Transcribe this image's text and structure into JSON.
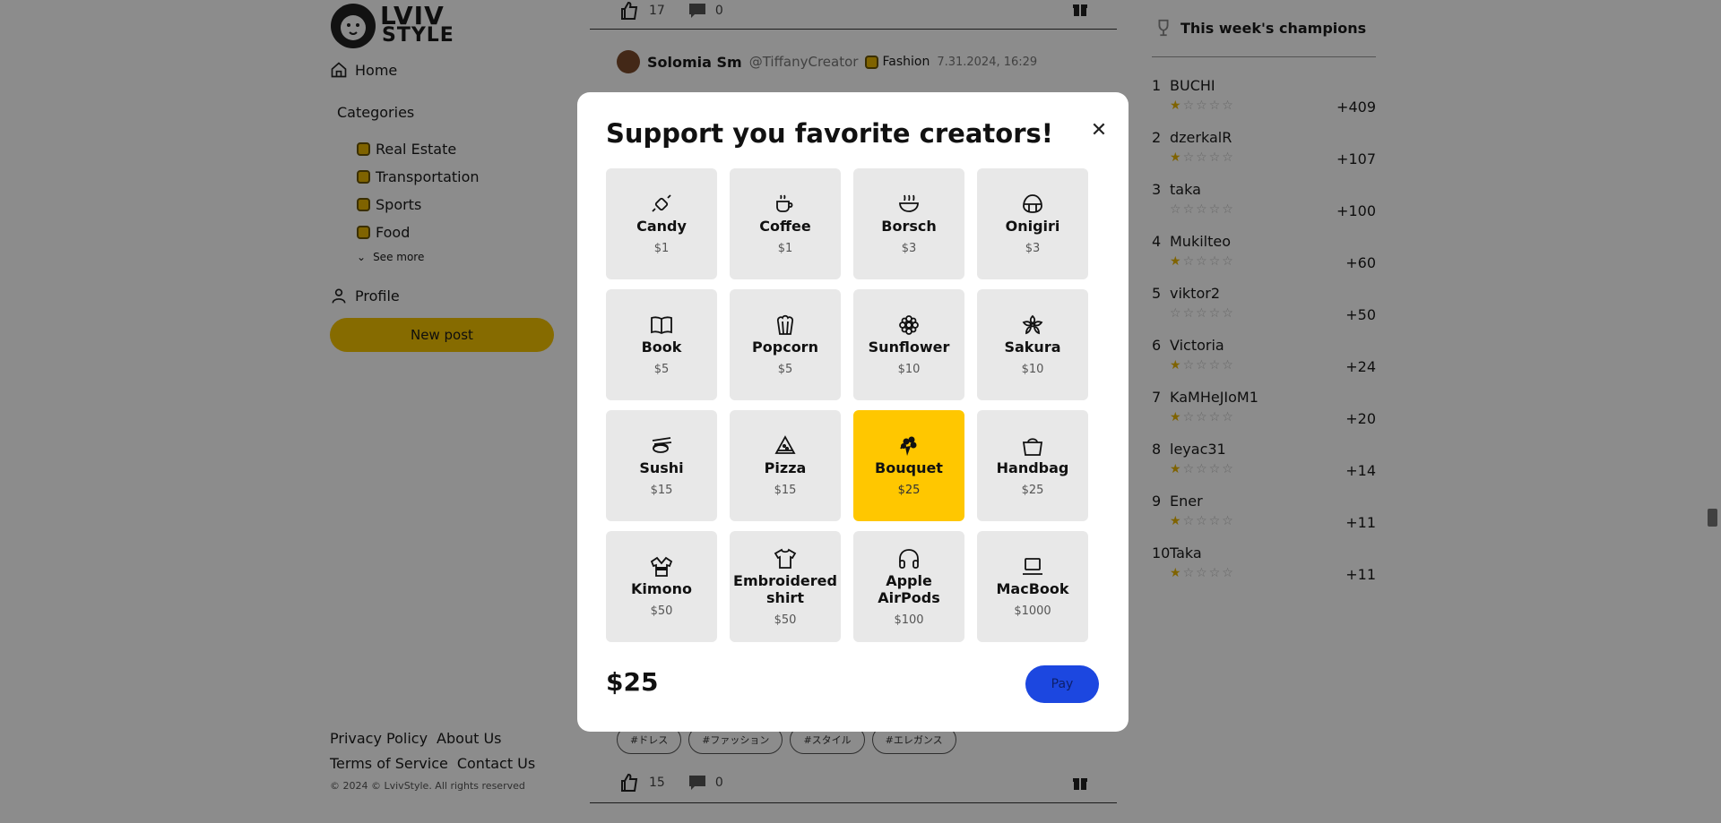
{
  "brand": {
    "line1": "LVIV",
    "line2": "STYLE"
  },
  "nav": {
    "home": "Home",
    "profile": "Profile",
    "new_post": "New post"
  },
  "categories": {
    "title": "Categories",
    "items": [
      "Real Estate",
      "Transportation",
      "Sports",
      "Food"
    ],
    "see_more": "See more"
  },
  "footer": {
    "privacy": "Privacy Policy",
    "about": "About Us",
    "terms": "Terms of Service",
    "contact": "Contact Us",
    "copyright": "© 2024 © LvivStyle. All rights reserved"
  },
  "feed": {
    "top_post": {
      "likes": "17",
      "comments": "0"
    },
    "post": {
      "author": "Solomia Sm",
      "handle": "@TiffanyCreator",
      "category": "Fashion",
      "date": "7.31.2024, 16:29"
    },
    "tags": [
      "#ドレス",
      "#ファッション",
      "#スタイル",
      "#エレガンス"
    ],
    "bottom_post": {
      "likes": "15",
      "comments": "0"
    }
  },
  "champions": {
    "title": "This week's champions",
    "list": [
      {
        "rank": "1",
        "name": "BUCHI",
        "score": "+409",
        "stars": 1
      },
      {
        "rank": "2",
        "name": "dzerkalR",
        "score": "+107",
        "stars": 1
      },
      {
        "rank": "3",
        "name": "taka",
        "score": "+100",
        "stars": 0
      },
      {
        "rank": "4",
        "name": "Mukilteo",
        "score": "+60",
        "stars": 1
      },
      {
        "rank": "5",
        "name": "viktor2",
        "score": "+50",
        "stars": 0
      },
      {
        "rank": "6",
        "name": "Victoria",
        "score": "+24",
        "stars": 1
      },
      {
        "rank": "7",
        "name": "KaMHeJIoM1",
        "score": "+20",
        "stars": 1
      },
      {
        "rank": "8",
        "name": "leyac31",
        "score": "+14",
        "stars": 1
      },
      {
        "rank": "9",
        "name": "Ener",
        "score": "+11",
        "stars": 1
      },
      {
        "rank": "10",
        "name": "Taka",
        "score": "+11",
        "stars": 1
      }
    ]
  },
  "modal": {
    "title": "Support you favorite creators!",
    "total": "$25",
    "pay_label": "Pay",
    "selected": "Bouquet",
    "gifts": [
      {
        "name": "Candy",
        "price": "$1",
        "icon": "candy-icon"
      },
      {
        "name": "Coffee",
        "price": "$1",
        "icon": "coffee-icon"
      },
      {
        "name": "Borsch",
        "price": "$3",
        "icon": "soup-bowl-icon"
      },
      {
        "name": "Onigiri",
        "price": "$3",
        "icon": "onigiri-icon"
      },
      {
        "name": "Book",
        "price": "$5",
        "icon": "book-icon"
      },
      {
        "name": "Popcorn",
        "price": "$5",
        "icon": "popcorn-icon"
      },
      {
        "name": "Sunflower",
        "price": "$10",
        "icon": "sunflower-icon"
      },
      {
        "name": "Sakura",
        "price": "$10",
        "icon": "sakura-icon"
      },
      {
        "name": "Sushi",
        "price": "$15",
        "icon": "sushi-icon"
      },
      {
        "name": "Pizza",
        "price": "$15",
        "icon": "pizza-icon"
      },
      {
        "name": "Bouquet",
        "price": "$25",
        "icon": "bouquet-icon"
      },
      {
        "name": "Handbag",
        "price": "$25",
        "icon": "handbag-icon"
      },
      {
        "name": "Kimono",
        "price": "$50",
        "icon": "kimono-icon"
      },
      {
        "name": "Embroidered shirt",
        "price": "$50",
        "icon": "shirt-icon"
      },
      {
        "name": "Apple AirPods",
        "price": "$100",
        "icon": "headphones-icon"
      },
      {
        "name": "MacBook",
        "price": "$1000",
        "icon": "laptop-icon"
      }
    ]
  },
  "colors": {
    "accent": "#ffc700",
    "pay": "#1c47e0",
    "star": "#e8b400"
  }
}
